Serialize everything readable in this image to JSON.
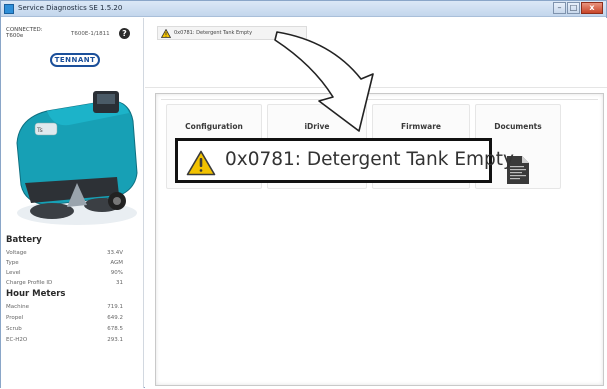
{
  "window": {
    "title": "Service Diagnostics SE 1.5.20",
    "minimize_glyph": "–",
    "maximize_glyph": "□",
    "close_glyph": "x"
  },
  "sidebar": {
    "connection_status": "CONNECTED:",
    "model": "T600e",
    "serial": "T600E-1/1811",
    "brand": "TENNANT",
    "battery": {
      "title": "Battery",
      "rows": [
        {
          "label": "Voltage",
          "value": "33.4V"
        },
        {
          "label": "Type",
          "value": "AGM"
        },
        {
          "label": "Level",
          "value": "90%"
        },
        {
          "label": "Charge Profile ID",
          "value": "31"
        }
      ]
    },
    "hour_meters": {
      "title": "Hour Meters",
      "rows": [
        {
          "label": "Machine",
          "value": "719.1"
        },
        {
          "label": "Propel",
          "value": "649.2"
        },
        {
          "label": "Scrub",
          "value": "678.5"
        },
        {
          "label": "EC-H2O",
          "value": "293.1"
        }
      ]
    }
  },
  "alert": {
    "text": "0x0781: Detergent Tank Empty",
    "callout_text": "0x0781: Detergent Tank Empty",
    "icon": "warning-triangle-icon",
    "color": "#f2c200"
  },
  "tabs": [
    {
      "label": "Configuration"
    },
    {
      "label": "iDrive"
    },
    {
      "label": "Firmware"
    },
    {
      "label": "Documents"
    }
  ],
  "colors": {
    "brand_blue": "#1b4f9a",
    "machine_teal": "#17a0b5",
    "warning_yellow": "#f2c200"
  }
}
